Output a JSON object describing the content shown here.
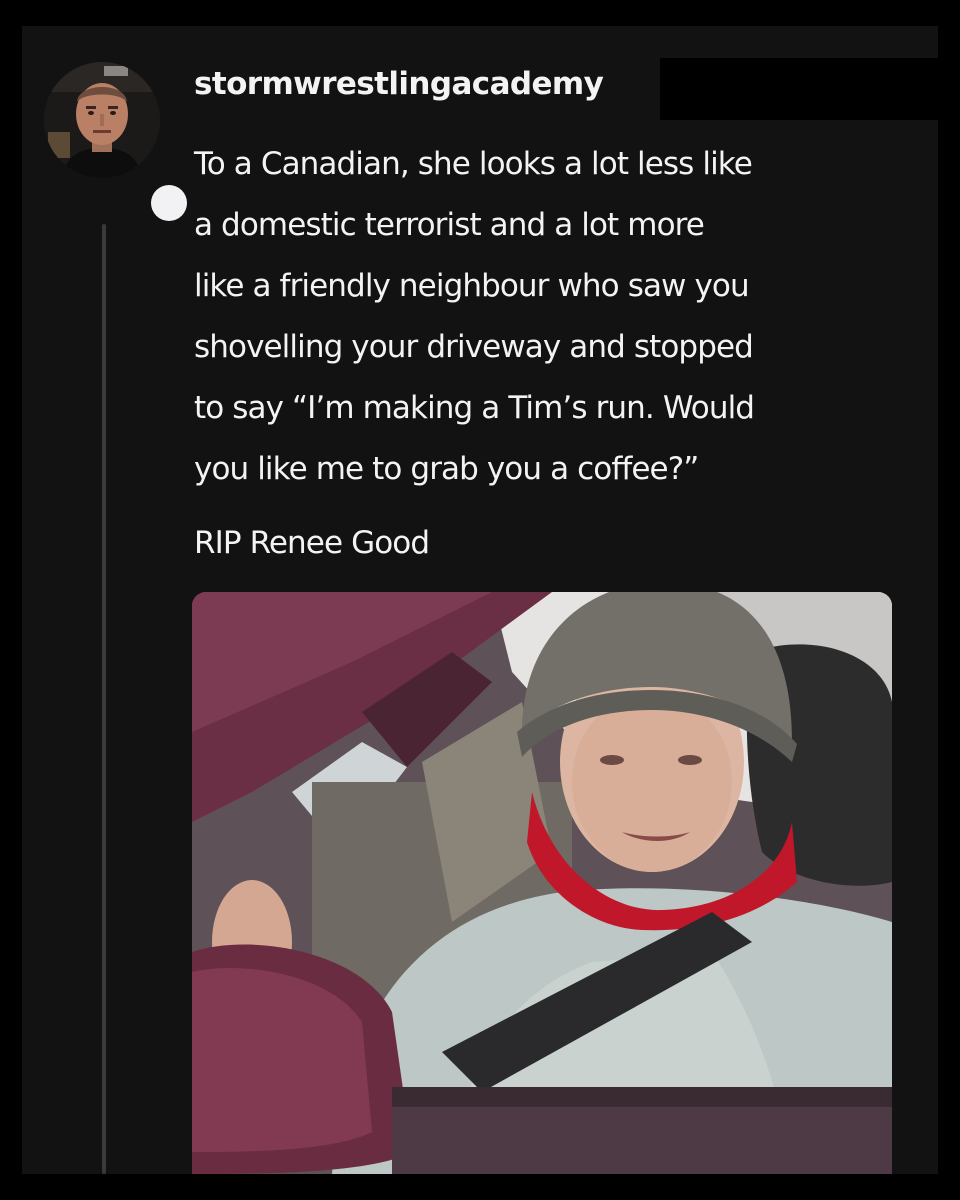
{
  "post": {
    "username": "stormwrestlingacademy",
    "body_lines": [
      "To a Canadian, she looks a lot less like",
      "a domestic terrorist and a lot more",
      "like a friendly neighbour who saw you",
      "shovelling your driveway and stopped",
      "to say “I’m making a Tim’s run. Would",
      "you like me to grab you a coffee?”"
    ],
    "signoff": "RIP Renee Good"
  },
  "colors": {
    "background": "#121212",
    "text": "#f3f3f3",
    "thread_line": "#3a3a3a"
  }
}
